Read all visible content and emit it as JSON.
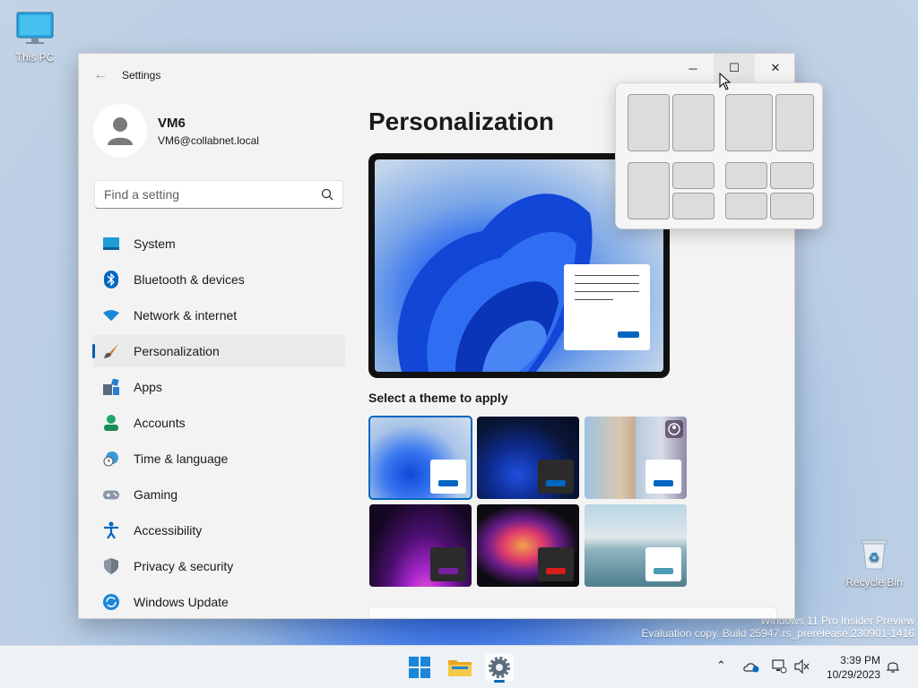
{
  "desktop": {
    "icons": [
      {
        "label": "This PC",
        "icon": "monitor-icon"
      },
      {
        "label": "Recycle Bin",
        "icon": "recycle-bin-icon"
      }
    ],
    "watermark": {
      "line1": "Windows 11 Pro Insider Preview",
      "line2": "Evaluation copy. Build 25947.rs_prerelease.230901-1416"
    }
  },
  "window": {
    "title": "Settings",
    "back_icon": "back-arrow-icon",
    "controls": {
      "minimize": "─",
      "maximize": "☐",
      "close": "✕"
    }
  },
  "user": {
    "name": "VM6",
    "email": "VM6@collabnet.local"
  },
  "search": {
    "placeholder": "Find a setting",
    "value": "",
    "icon": "search-icon"
  },
  "nav": {
    "items": [
      {
        "label": "System",
        "icon": "system-icon",
        "selected": false
      },
      {
        "label": "Bluetooth & devices",
        "icon": "bluetooth-icon",
        "selected": false
      },
      {
        "label": "Network & internet",
        "icon": "wifi-icon",
        "selected": false
      },
      {
        "label": "Personalization",
        "icon": "brush-icon",
        "selected": true
      },
      {
        "label": "Apps",
        "icon": "apps-icon",
        "selected": false
      },
      {
        "label": "Accounts",
        "icon": "accounts-icon",
        "selected": false
      },
      {
        "label": "Time & language",
        "icon": "globe-clock-icon",
        "selected": false
      },
      {
        "label": "Gaming",
        "icon": "gamepad-icon",
        "selected": false
      },
      {
        "label": "Accessibility",
        "icon": "accessibility-icon",
        "selected": false
      },
      {
        "label": "Privacy & security",
        "icon": "shield-icon",
        "selected": false
      },
      {
        "label": "Windows Update",
        "icon": "update-icon",
        "selected": false
      }
    ]
  },
  "main": {
    "heading": "Personalization",
    "theme_prompt": "Select a theme to apply",
    "themes": [
      {
        "name": "windows-light",
        "selected": true
      },
      {
        "name": "windows-dark",
        "selected": false
      },
      {
        "name": "windows-spotlight",
        "selected": false
      },
      {
        "name": "glow",
        "selected": false
      },
      {
        "name": "captured-motion",
        "selected": false
      },
      {
        "name": "flow",
        "selected": false
      }
    ]
  },
  "colors": {
    "accent": "#0067c0",
    "glow_accent": "#7a1fa2",
    "motion_accent": "#d81b1b",
    "flow_accent": "#4a9bb3"
  },
  "taskbar": {
    "apps": [
      {
        "name": "start",
        "icon": "windows-logo-icon"
      },
      {
        "name": "file-explorer",
        "icon": "folder-icon"
      },
      {
        "name": "settings",
        "icon": "gear-icon",
        "active": true
      }
    ],
    "tray": [
      "chevron-up-icon",
      "onedrive-icon",
      "network-icon",
      "volume-muted-icon"
    ],
    "time": "3:39 PM",
    "date": "10/29/2023",
    "notification_icon": "bell-icon"
  }
}
